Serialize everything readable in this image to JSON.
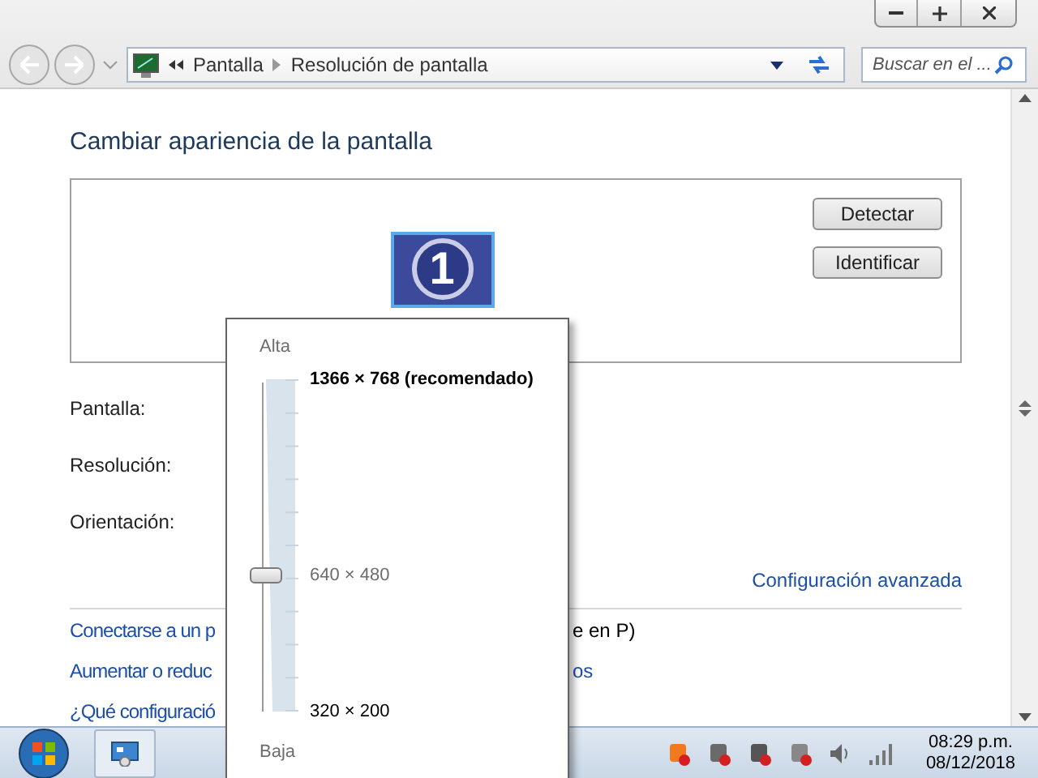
{
  "address_bar": {
    "breadcrumbs": [
      "Pantalla",
      "Resolución de pantalla"
    ]
  },
  "search": {
    "placeholder": "Buscar en el ..."
  },
  "heading": "Cambiar apariencia de la pantalla",
  "monitor": {
    "number": "1",
    "selected": true
  },
  "buttons": [
    "Detectar",
    "Identificar"
  ],
  "fields": [
    "Pantalla:",
    "Resolución:",
    "Orientación:"
  ],
  "advanced_link": "Configuración avanzada",
  "links": [
    {
      "visible_start": "Conectarse a un p",
      "visible_end": "e en P)",
      "end_is_link": false
    },
    {
      "visible_start": "Aumentar o reduc",
      "visible_end": "os",
      "end_is_link": true
    },
    {
      "visible_start": "¿Qué configuració"
    }
  ],
  "resolution_popup": {
    "high_label": "Alta",
    "low_label": "Baja",
    "level": 0.41,
    "options": [
      {
        "label": "1366 × 768 (recomendado)",
        "kind": "recommended"
      },
      {
        "label": "640 × 480",
        "kind": "current"
      },
      {
        "label": "320 × 200",
        "kind": "normal"
      }
    ]
  },
  "taskbar": {
    "time": "08:29 p.m.",
    "date": "08/12/2018"
  }
}
